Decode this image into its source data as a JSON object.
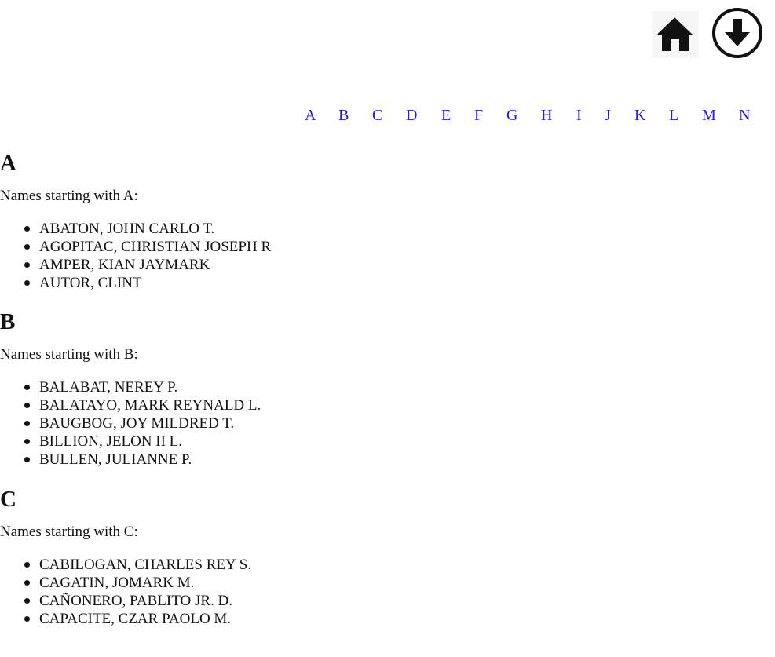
{
  "header": {
    "home_icon": "home-icon",
    "download_icon": "download-circle-icon"
  },
  "alphabet_nav": [
    "A",
    "B",
    "C",
    "D",
    "E",
    "F",
    "G",
    "H",
    "I",
    "J",
    "K",
    "L",
    "M",
    "N"
  ],
  "sections": [
    {
      "letter": "A",
      "intro": "Names starting with A:",
      "names": [
        "ABATON, JOHN CARLO T.",
        "AGOPITAC, CHRISTIAN JOSEPH R",
        "AMPER, KIAN JAYMARK",
        "AUTOR, CLINT"
      ]
    },
    {
      "letter": "B",
      "intro": "Names starting with B:",
      "names": [
        "BALABAT, NEREY P.",
        "BALATAYO, MARK REYNALD L.",
        "BAUGBOG, JOY MILDRED T.",
        "BILLION, JELON II L.",
        "BULLEN, JULIANNE P."
      ]
    },
    {
      "letter": "C",
      "intro": "Names starting with C:",
      "names": [
        "CABILOGAN, CHARLES REY S.",
        "CAGATIN, JOMARK M.",
        "CAÑONERO, PABLITO JR. D.",
        "CAPACITE, CZAR PAOLO M."
      ]
    }
  ],
  "colors": {
    "link": "#2a1bd1",
    "text": "#111111",
    "background": "#ffffff"
  }
}
